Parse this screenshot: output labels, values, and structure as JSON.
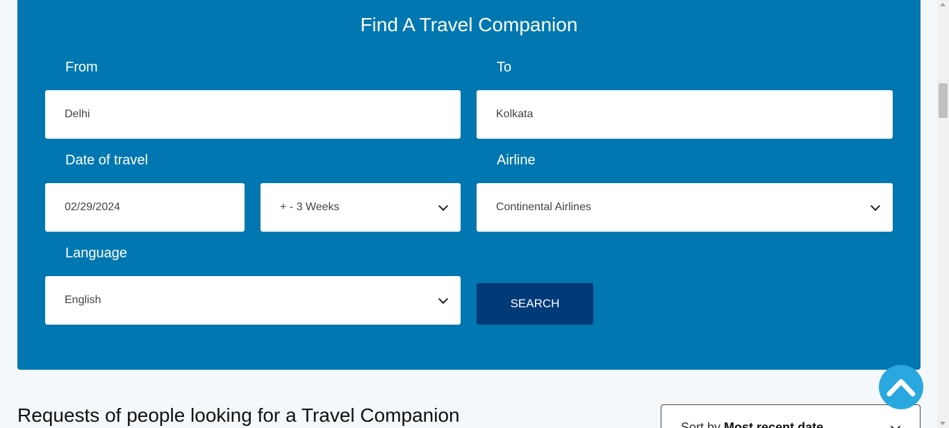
{
  "search_panel": {
    "title": "Find A Travel Companion",
    "from": {
      "label": "From",
      "value": "Delhi"
    },
    "to": {
      "label": "To",
      "value": "Kolkata"
    },
    "date": {
      "label": "Date of travel",
      "value": "02/29/2024",
      "range_value": "+ - 3 Weeks"
    },
    "airline": {
      "label": "Airline",
      "value": "Continental Airlines"
    },
    "language": {
      "label": "Language",
      "value": "English"
    },
    "search_label": "SEARCH"
  },
  "requests": {
    "heading": "Requests of people looking for a Travel Companion",
    "sort_prefix": "Sort by",
    "sort_value": "Most recent date"
  },
  "icons": {
    "scroll_top": "chevron-up-icon",
    "dropdown": "chevron-down-icon"
  },
  "colors": {
    "panel": "#0077b0",
    "button": "#003a78",
    "scroll_top": "#29a8e0"
  }
}
